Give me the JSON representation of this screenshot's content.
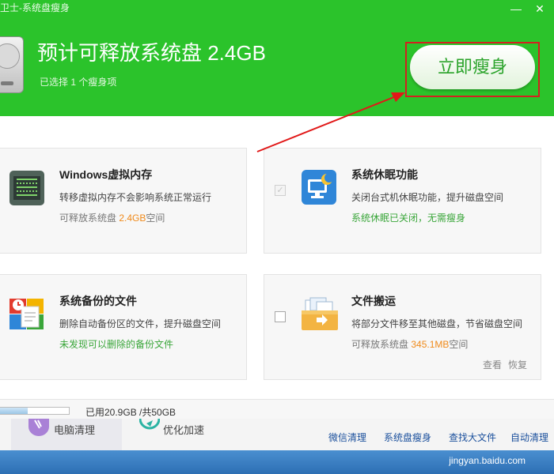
{
  "window": {
    "title": "卫士-系统盘瘦身",
    "minimize_glyph": "—",
    "close_glyph": "✕"
  },
  "header": {
    "headline": "预计可释放系统盘 2.4GB",
    "subline": "已选择 1 个瘦身项",
    "slim_button": "立即瘦身",
    "icon": "hard-disk-icon"
  },
  "cards": [
    {
      "title": "Windows虚拟内存",
      "desc": "转移虚拟内存不会影响系统正常运行",
      "note_prefix": "可释放系统盘 ",
      "note_value": "2.4GB",
      "note_suffix": "空间",
      "checked": true,
      "icon": "memory-chip-icon"
    },
    {
      "title": "系统休眠功能",
      "desc": "关闭台式机休眠功能，提升磁盘空间",
      "note": "系统休眠已关闭，无需瘦身",
      "checked": true,
      "disabled": true,
      "icon": "hibernate-monitor-icon"
    },
    {
      "title": "系统备份的文件",
      "desc": "删除自动备份区的文件，提升磁盘空间",
      "note": "未发现可以删除的备份文件",
      "icon": "backup-files-icon"
    },
    {
      "title": "文件搬运",
      "desc": "将部分文件移至其他磁盘，节省磁盘空间",
      "note_prefix": "可释放系统盘 ",
      "note_value": "345.1MB",
      "note_suffix": "空间",
      "checked": false,
      "icon": "folder-move-icon",
      "link_view": "查看",
      "link_restore": "恢复"
    }
  ],
  "status": {
    "text": "已用20.9GB /共50GB",
    "used_gb": 20.9,
    "total_gb": 50
  },
  "taskbar": {
    "tab1": "电脑清理",
    "tab2": "优化加速"
  },
  "bottom_links": [
    "微信清理",
    "系统盘瘦身",
    "查找大文件",
    "自动清理"
  ],
  "watermark": "jingyan.baidu.com",
  "colors": {
    "header_green": "#2bc32b",
    "highlight_red": "#d42020",
    "orange_value": "#f08a1a",
    "green_note": "#3aa63a"
  }
}
